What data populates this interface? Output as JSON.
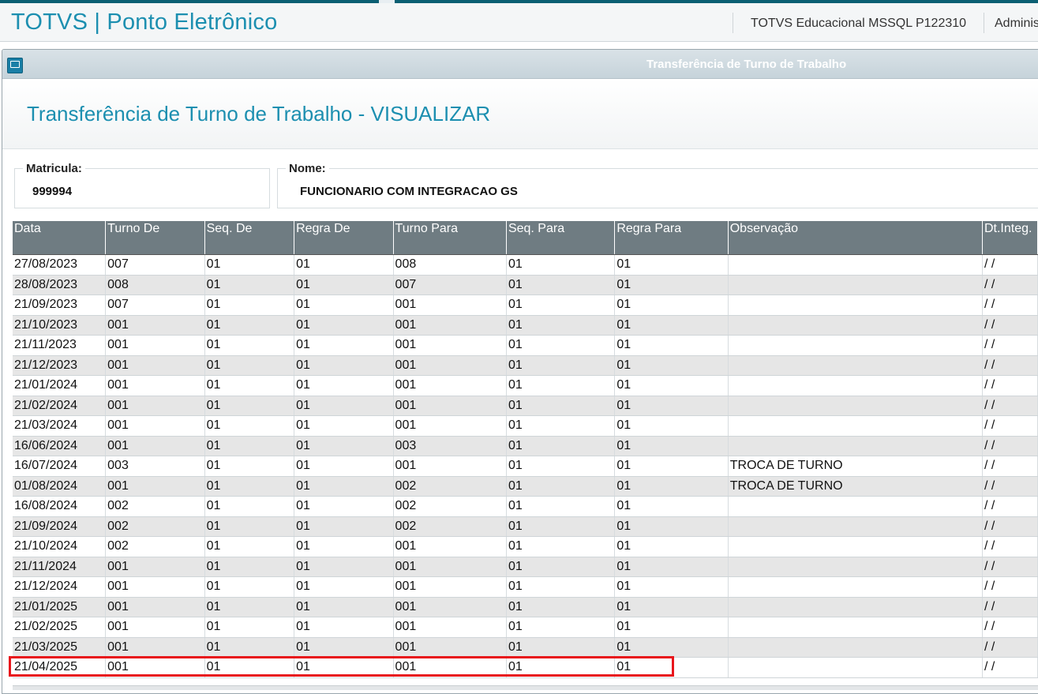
{
  "app": {
    "title": "TOTVS | Ponto Eletrônico",
    "environment": "TOTVS Educacional MSSQL P122310",
    "user": "Adminis"
  },
  "window": {
    "title": "Transferência de Turno de Trabalho"
  },
  "page": {
    "title": "Transferência de Turno de Trabalho - VISUALIZAR"
  },
  "fields": {
    "matricula": {
      "label": "Matricula:",
      "value": "999994"
    },
    "nome": {
      "label": "Nome:",
      "value": "FUNCIONARIO COM INTEGRACAO GS"
    }
  },
  "table": {
    "columns": [
      "Data",
      "Turno De",
      "Seq. De",
      "Regra De",
      "Turno Para",
      "Seq. Para",
      "Regra Para",
      "Observação",
      "Dt.Integ."
    ],
    "rows": [
      [
        "27/08/2023",
        "007",
        "01",
        "01",
        "008",
        "01",
        "01",
        "",
        " / /"
      ],
      [
        "28/08/2023",
        "008",
        "01",
        "01",
        "007",
        "01",
        "01",
        "",
        " / /"
      ],
      [
        "21/09/2023",
        "007",
        "01",
        "01",
        "001",
        "01",
        "01",
        "",
        " / /"
      ],
      [
        "21/10/2023",
        "001",
        "01",
        "01",
        "001",
        "01",
        "01",
        "",
        " / /"
      ],
      [
        "21/11/2023",
        "001",
        "01",
        "01",
        "001",
        "01",
        "01",
        "",
        " / /"
      ],
      [
        "21/12/2023",
        "001",
        "01",
        "01",
        "001",
        "01",
        "01",
        "",
        " / /"
      ],
      [
        "21/01/2024",
        "001",
        "01",
        "01",
        "001",
        "01",
        "01",
        "",
        " / /"
      ],
      [
        "21/02/2024",
        "001",
        "01",
        "01",
        "001",
        "01",
        "01",
        "",
        " / /"
      ],
      [
        "21/03/2024",
        "001",
        "01",
        "01",
        "001",
        "01",
        "01",
        "",
        " / /"
      ],
      [
        "16/06/2024",
        "001",
        "01",
        "01",
        "003",
        "01",
        "01",
        "",
        " / /"
      ],
      [
        "16/07/2024",
        "003",
        "01",
        "01",
        "001",
        "01",
        "01",
        "TROCA DE TURNO",
        " / /"
      ],
      [
        "01/08/2024",
        "001",
        "01",
        "01",
        "002",
        "01",
        "01",
        "TROCA DE TURNO",
        " / /"
      ],
      [
        "16/08/2024",
        "002",
        "01",
        "01",
        "002",
        "01",
        "01",
        "",
        " / /"
      ],
      [
        "21/09/2024",
        "002",
        "01",
        "01",
        "002",
        "01",
        "01",
        "",
        " / /"
      ],
      [
        "21/10/2024",
        "002",
        "01",
        "01",
        "001",
        "01",
        "01",
        "",
        " / /"
      ],
      [
        "21/11/2024",
        "001",
        "01",
        "01",
        "001",
        "01",
        "01",
        "",
        " / /"
      ],
      [
        "21/12/2024",
        "001",
        "01",
        "01",
        "001",
        "01",
        "01",
        "",
        " / /"
      ],
      [
        "21/01/2025",
        "001",
        "01",
        "01",
        "001",
        "01",
        "01",
        "",
        " / /"
      ],
      [
        "21/02/2025",
        "001",
        "01",
        "01",
        "001",
        "01",
        "01",
        "",
        " / /"
      ],
      [
        "21/03/2025",
        "001",
        "01",
        "01",
        "001",
        "01",
        "01",
        "",
        " / /"
      ],
      [
        "21/04/2025",
        "001",
        "01",
        "01",
        "001",
        "01",
        "01",
        "",
        " / /"
      ]
    ],
    "highlighted_row_index": 20
  },
  "colors": {
    "brand": "#1c8fb0",
    "header_bg": "#6f7c82",
    "highlight": "#e8161c"
  }
}
